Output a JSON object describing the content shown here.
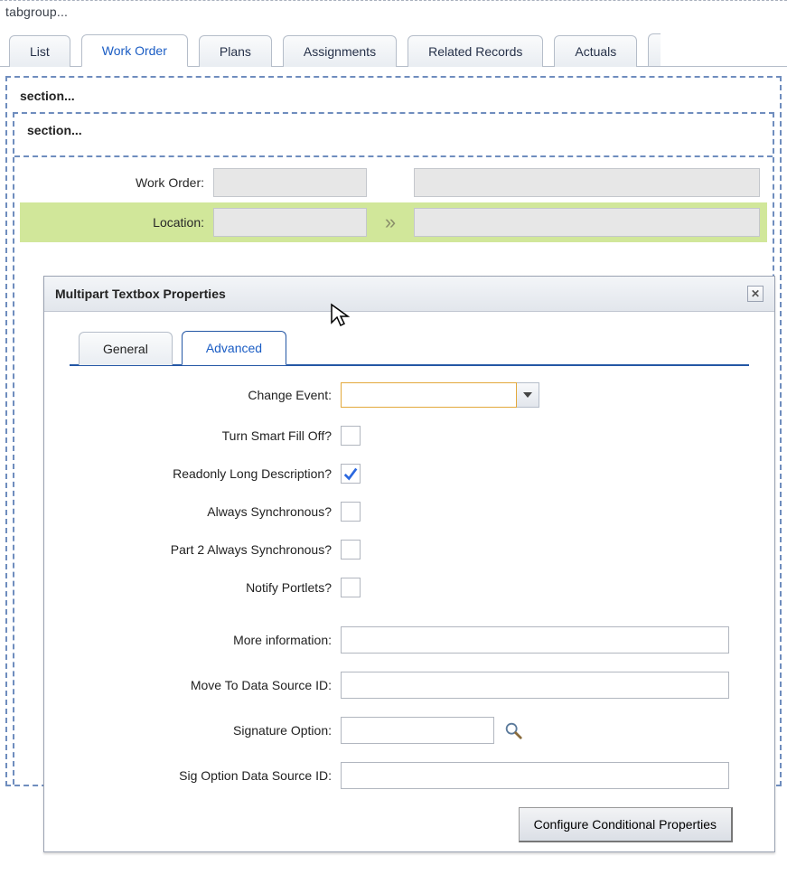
{
  "breadcrumb": "tabgroup...",
  "tabs": [
    "List",
    "Work Order",
    "Plans",
    "Assignments",
    "Related Records",
    "Actuals"
  ],
  "activeTab": 1,
  "outerSection": "section...",
  "innerSection": "section...",
  "fields": {
    "workOrderLabel": "Work Order:",
    "locationLabel": "Location:"
  },
  "dialog": {
    "title": "Multipart Textbox Properties",
    "tabs": {
      "general": "General",
      "advanced": "Advanced"
    },
    "activeTab": "advanced",
    "form": {
      "changeEvent": {
        "label": "Change Event:",
        "value": ""
      },
      "turnSmartFillOff": {
        "label": "Turn Smart Fill Off?",
        "checked": false
      },
      "readonlyLongDesc": {
        "label": "Readonly Long Description?",
        "checked": true
      },
      "alwaysSync": {
        "label": "Always Synchronous?",
        "checked": false
      },
      "part2AlwaysSync": {
        "label": "Part 2 Always Synchronous?",
        "checked": false
      },
      "notifyPortlets": {
        "label": "Notify Portlets?",
        "checked": false
      },
      "moreInfo": {
        "label": "More information:",
        "value": ""
      },
      "moveToDsId": {
        "label": "Move To Data Source ID:",
        "value": ""
      },
      "signatureOption": {
        "label": "Signature Option:",
        "value": ""
      },
      "sigOptionDsId": {
        "label": "Sig Option Data Source ID:",
        "value": ""
      }
    },
    "configureButton": "Configure Conditional Properties"
  }
}
